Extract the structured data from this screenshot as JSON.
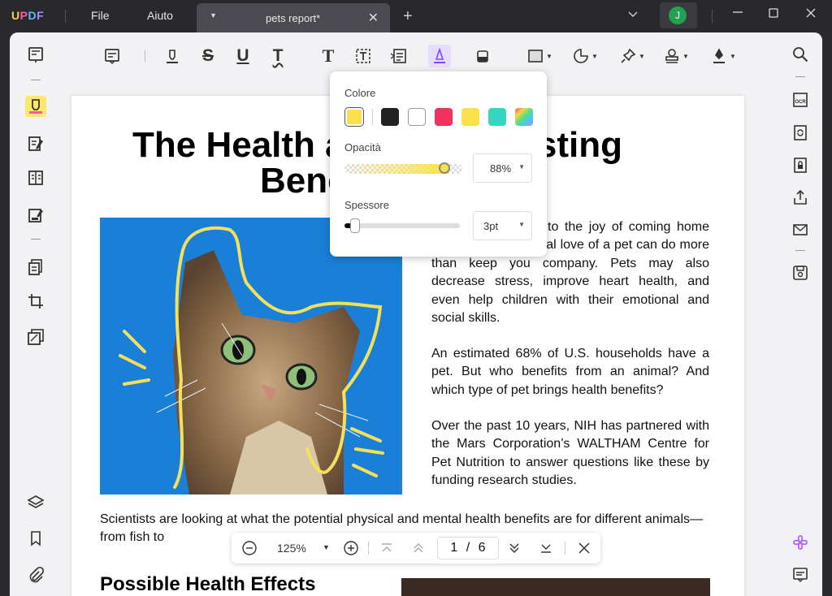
{
  "app": {
    "logo": "UPDF"
  },
  "menu": {
    "file": "File",
    "help": "Aiuto"
  },
  "tab": {
    "title": "pets report*"
  },
  "user": {
    "initial": "J"
  },
  "document": {
    "title_part1": "The Health a",
    "title_part2": "osting",
    "title_line2": "Bene",
    "p1": "to the joy of coming home on. The unconditional love of a pet can do more than keep you company. Pets may also decrease stress, improve heart health, and even help children with their emotional and social skills.",
    "p2": "An estimated 68% of U.S. households have a pet. But who benefits from an animal? And which type of pet brings health benefits?",
    "p3": "Over the past 10 years, NIH has partnered with the Mars Corporation’s WALTHAM Centre for Pet Nutrition to answer questions like these by funding research studies.",
    "p4": "Scientists are looking at what the potential physical and mental health benefits are for different animals—from fish to",
    "heading2": "Possible Health Effects"
  },
  "popup": {
    "color_label": "Colore",
    "opacity_label": "Opacità",
    "opacity_value": "88%",
    "opacity_level": 0.88,
    "thickness_label": "Spessore",
    "thickness_value": "3pt",
    "thickness_level": 0.06,
    "swatches": [
      "#222222",
      "#ffffff",
      "#f0325c",
      "#fbe04a",
      "#35d6c0",
      "gradient"
    ],
    "selected_color": "#fbe04a"
  },
  "nav": {
    "zoom": "125%",
    "page_current": "1",
    "page_sep": "/",
    "page_total": "6"
  }
}
